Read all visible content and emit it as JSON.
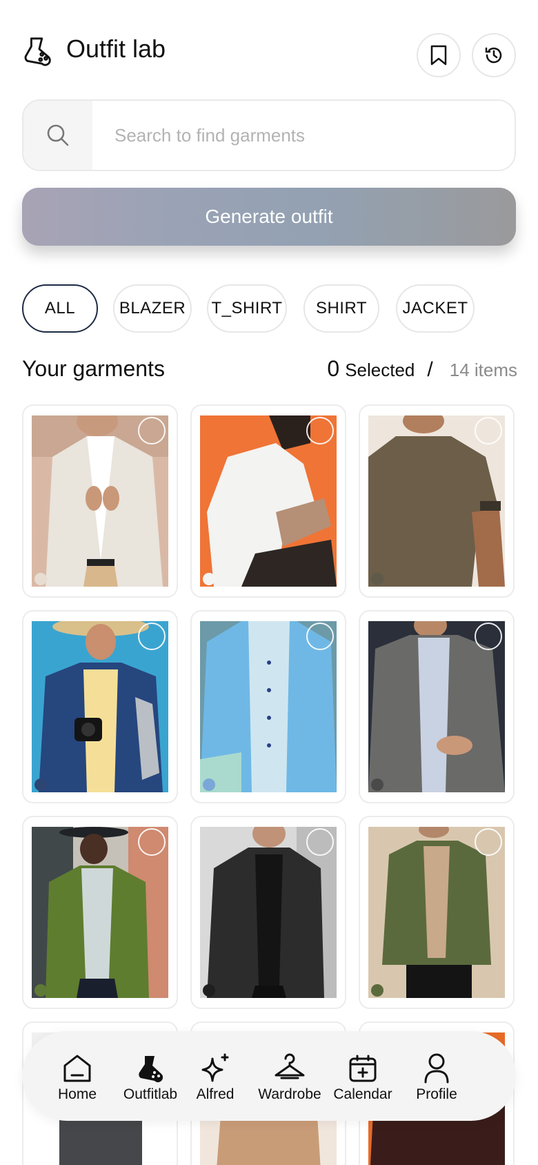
{
  "header": {
    "title": "Outfit lab"
  },
  "search": {
    "placeholder": "Search to find garments"
  },
  "generate": {
    "label": "Generate outfit"
  },
  "filters": [
    {
      "label": "ALL",
      "active": true
    },
    {
      "label": "BLAZER",
      "active": false
    },
    {
      "label": "T_SHIRT",
      "active": false
    },
    {
      "label": "SHIRT",
      "active": false
    },
    {
      "label": "JACKET",
      "active": false
    }
  ],
  "garments_section": {
    "title": "Your garments",
    "selected_count": "0",
    "selected_label": "Selected",
    "separator": "/",
    "total_label": "14 items"
  },
  "garments": [
    {
      "kind": "blazer",
      "color": "#e7ddd1"
    },
    {
      "kind": "t-shirt",
      "color": "#f4f4f2"
    },
    {
      "kind": "t-shirt",
      "color": "#5f5a4a"
    },
    {
      "kind": "shirt",
      "color": "#2d4573"
    },
    {
      "kind": "blazer",
      "color": "#7aa7d8"
    },
    {
      "kind": "blazer",
      "color": "#4a4a4a"
    },
    {
      "kind": "blazer",
      "color": "#5e7a36"
    },
    {
      "kind": "jacket",
      "color": "#1f1f1f"
    },
    {
      "kind": "jacket",
      "color": "#5b6a3c"
    }
  ],
  "nav": [
    {
      "label": "Home",
      "icon": "home-icon"
    },
    {
      "label": "Outfitlab",
      "icon": "flask-icon"
    },
    {
      "label": "Alfred",
      "icon": "sparkle-icon"
    },
    {
      "label": "Wardrobe",
      "icon": "hanger-icon"
    },
    {
      "label": "Calendar",
      "icon": "calendar-icon"
    },
    {
      "label": "Profile",
      "icon": "profile-icon"
    }
  ]
}
